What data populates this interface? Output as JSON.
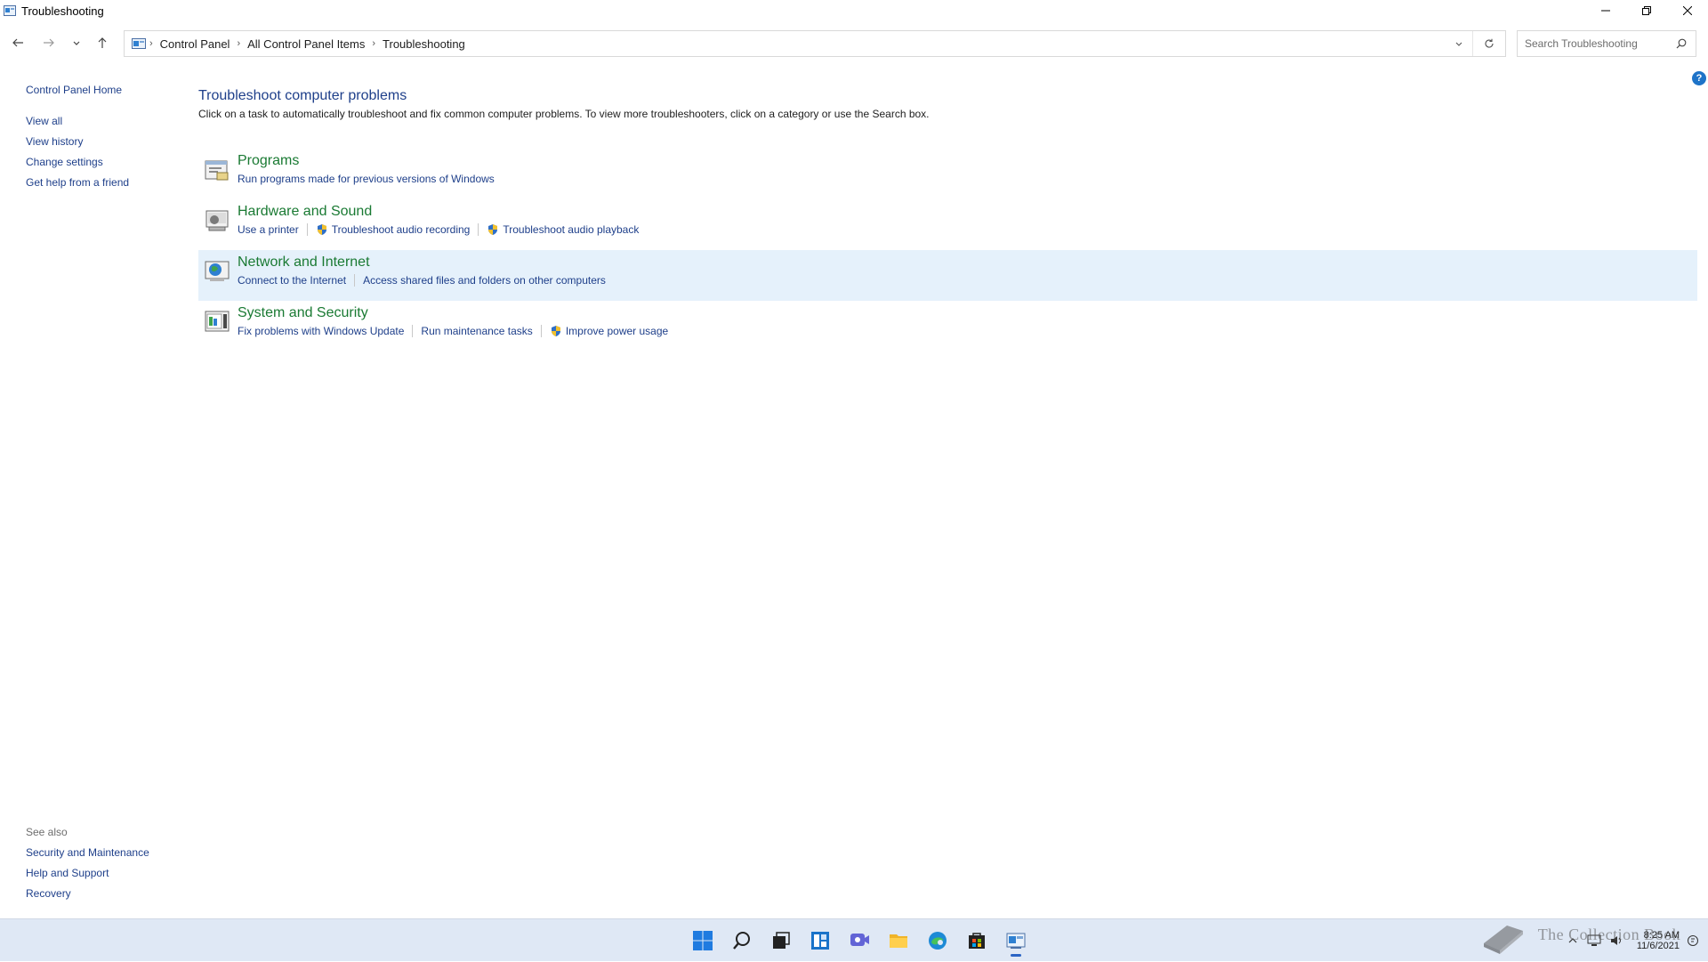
{
  "window": {
    "title": "Troubleshooting"
  },
  "breadcrumb": [
    "Control Panel",
    "All Control Panel Items",
    "Troubleshooting"
  ],
  "search": {
    "placeholder": "Search Troubleshooting"
  },
  "sidebar": {
    "home": "Control Panel Home",
    "links": [
      "View all",
      "View history",
      "Change settings",
      "Get help from a friend"
    ],
    "see_also_label": "See also",
    "see_also": [
      "Security and Maintenance",
      "Help and Support",
      "Recovery"
    ]
  },
  "main": {
    "title": "Troubleshoot computer problems",
    "description": "Click on a task to automatically troubleshoot and fix common computer problems. To view more troubleshooters, click on a category or use the Search box.",
    "categories": [
      {
        "title": "Programs",
        "tasks": [
          "Run programs made for previous versions of Windows"
        ]
      },
      {
        "title": "Hardware and Sound",
        "tasks": [
          "Use a printer",
          "Troubleshoot audio recording",
          "Troubleshoot audio playback"
        ]
      },
      {
        "title": "Network and Internet",
        "tasks": [
          "Connect to the Internet",
          "Access shared files and folders on other computers"
        ]
      },
      {
        "title": "System and Security",
        "tasks": [
          "Fix problems with Windows Update",
          "Run maintenance tasks",
          "Improve power usage"
        ]
      }
    ]
  },
  "help": {
    "label": "?"
  },
  "taskbar": {
    "clock_time": "8:25 AM",
    "clock_date": "11/6/2021",
    "icons": [
      "start-icon",
      "search-icon",
      "task-view-icon",
      "widgets-icon",
      "chat-icon",
      "file-explorer-icon",
      "edge-icon",
      "store-icon",
      "control-panel-icon"
    ]
  },
  "watermark": "The Collection Book",
  "colors": {
    "link": "#1e3f8a",
    "category": "#1a7a33",
    "selected": "#e5f1fb",
    "taskbar": "#dfe8f5"
  }
}
